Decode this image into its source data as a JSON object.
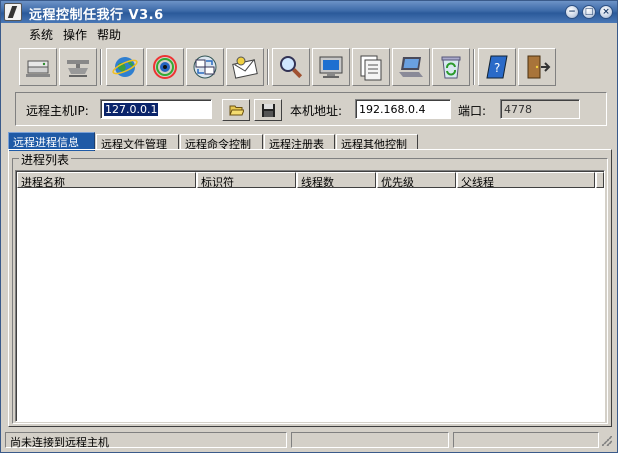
{
  "window": {
    "title": "远程控制任我行 V3.6",
    "buttons": {
      "minimize": "−",
      "maximize": "□",
      "close": "×"
    }
  },
  "menu": [
    {
      "label": "系统"
    },
    {
      "label": "操作"
    },
    {
      "label": "帮助"
    }
  ],
  "toolbar": {
    "icons": [
      "server-icon",
      "network-icon",
      "globe-icon",
      "eye-icon",
      "transfer-icon",
      "mail-icon",
      "magnifier-icon",
      "monitor-icon",
      "printer-icon",
      "laptop-icon",
      "recycle-icon",
      "help-book-icon",
      "exit-door-icon"
    ]
  },
  "connection": {
    "remote_ip_label": "远程主机IP:",
    "remote_ip_value": "127.0.0.1",
    "local_addr_label": "本机地址:",
    "local_addr_value": "192.168.0.4",
    "port_label": "端口:",
    "port_value": "4778"
  },
  "tabs": [
    {
      "label": "远程进程信息",
      "active": true
    },
    {
      "label": "远程文件管理"
    },
    {
      "label": "远程命令控制"
    },
    {
      "label": "远程注册表"
    },
    {
      "label": "远程其他控制"
    }
  ],
  "process_panel": {
    "title": "进程列表",
    "columns": [
      "进程名称",
      "标识符",
      "线程数",
      "优先级",
      "父线程"
    ]
  },
  "status": {
    "text": "尚未连接到远程主机",
    "pane2": "",
    "pane3": ""
  },
  "colors": {
    "titlebar": "#3d6aa8",
    "active_tab": "#1f5aa6",
    "face": "#d4d0c8"
  }
}
